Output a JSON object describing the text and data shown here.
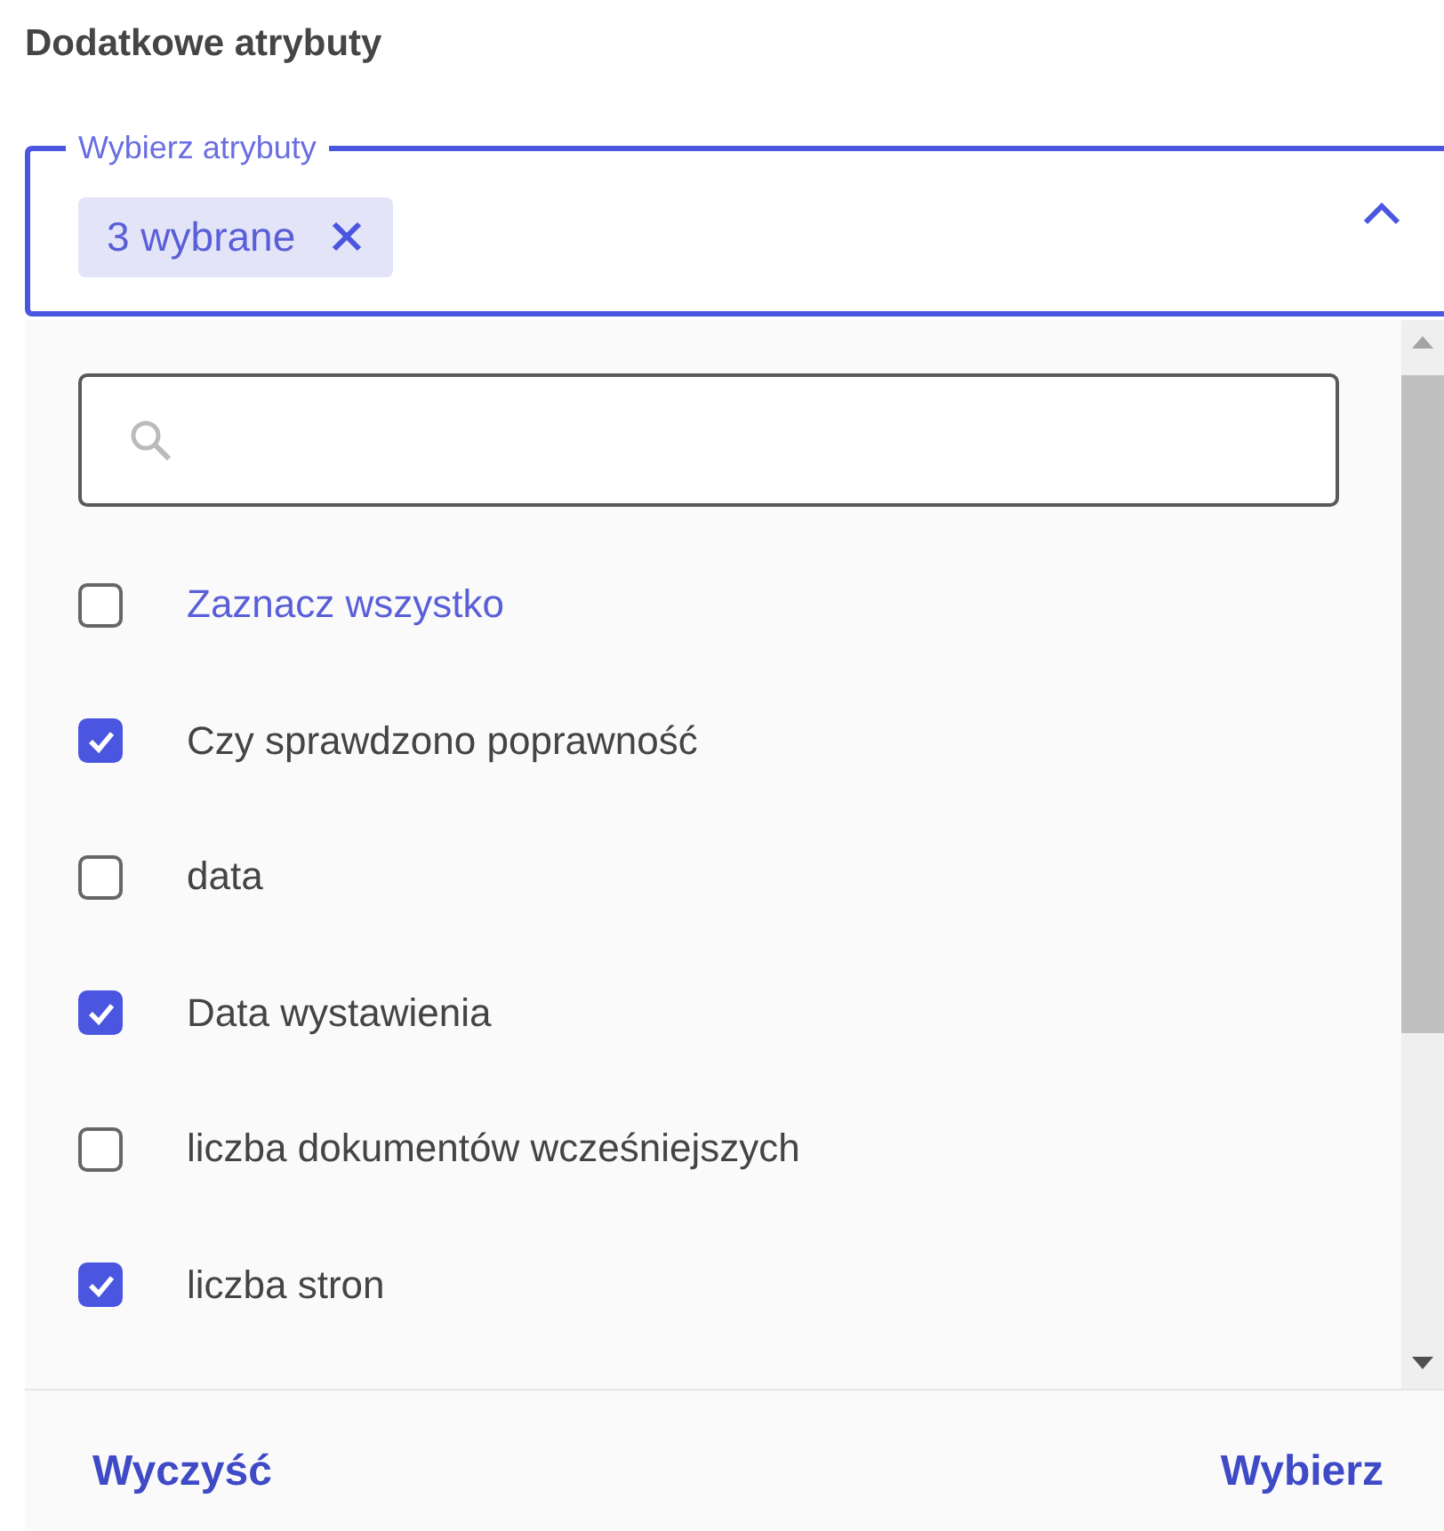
{
  "section_title": "Dodatkowe atrybuty",
  "select": {
    "label": "Wybierz atrybuty",
    "chip": "3 wybrane",
    "expanded": true
  },
  "options": [
    {
      "kind": "select-all",
      "label": "Zaznacz wszystko",
      "checked": false
    },
    {
      "kind": "option",
      "label": "Czy sprawdzono poprawność",
      "checked": true
    },
    {
      "kind": "option",
      "label": "data",
      "checked": false
    },
    {
      "kind": "option",
      "label": "Data wystawienia",
      "checked": true
    },
    {
      "kind": "option",
      "label": "liczba dokumentów wcześniejszych",
      "checked": false
    },
    {
      "kind": "option",
      "label": "liczba stron",
      "checked": true
    }
  ],
  "footer": {
    "clear": "Wyczyść",
    "confirm": "Wybierz"
  }
}
